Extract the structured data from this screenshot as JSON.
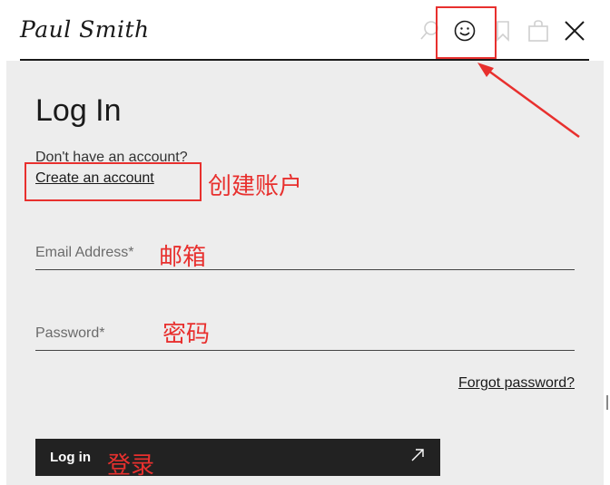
{
  "header": {
    "logo_text": "Paul Smith",
    "icons": [
      "search-icon",
      "account-icon",
      "bookmark-icon",
      "bag-icon",
      "close-icon"
    ]
  },
  "login": {
    "title": "Log In",
    "no_account_text": "Don't have an account?",
    "create_account_link": "Create an account",
    "email_label": "Email Address*",
    "password_label": "Password*",
    "forgot_link": "Forgot password?",
    "submit_label": "Log in"
  },
  "annotations": {
    "create_account": "创建账户",
    "email": "邮箱",
    "password": "密码",
    "login": "登录"
  },
  "colors": {
    "annotation_red": "#e8302e",
    "panel_bg": "#ededed",
    "button_bg": "#222222"
  }
}
